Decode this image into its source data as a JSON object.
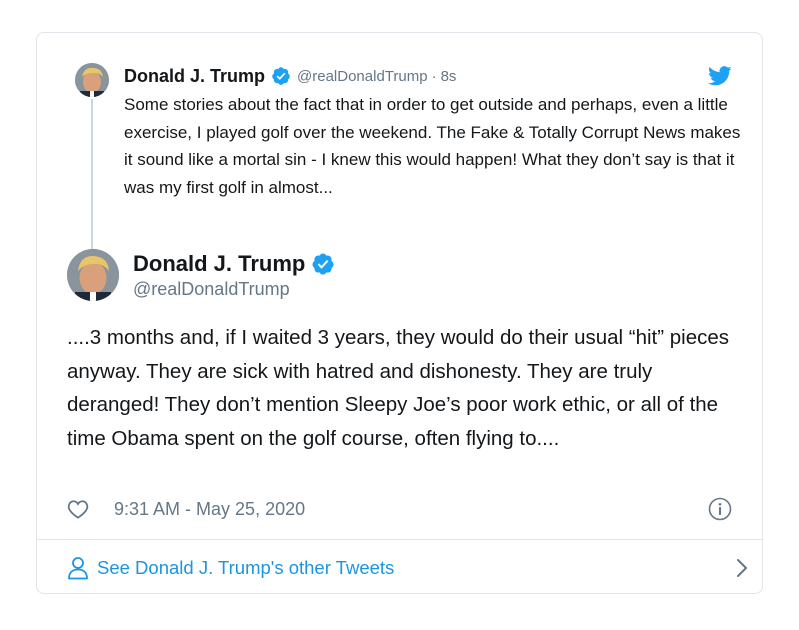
{
  "parent_tweet": {
    "display_name": "Donald J. Trump",
    "handle": "@realDonaldTrump",
    "separator": "·",
    "time_ago": "8s",
    "text": "Some stories about the fact that in order to get outside and perhaps, even a little exercise, I played golf over the weekend. The Fake & Totally Corrupt News makes it sound like a mortal sin - I knew this would happen! What they don’t say is that it was my first golf in almost...",
    "avatar_icon": "profile-photo",
    "verified_icon": "verified-badge-icon"
  },
  "main_tweet": {
    "display_name": "Donald J. Trump",
    "handle": "@realDonaldTrump",
    "text": "....3 months and, if I waited 3 years, they would do their usual “hit” pieces anyway. They are sick with hatred and dishonesty. They are truly deranged! They don’t mention Sleepy Joe’s poor work ethic,  or all of the time Obama spent on the golf course, often flying to....",
    "timestamp": "9:31 AM - May 25, 2020",
    "like_icon": "heart-icon",
    "info_icon": "info-icon"
  },
  "footer": {
    "label": "See Donald J. Trump's other Tweets",
    "icon": "person-icon",
    "chevron_icon": "chevron-right-icon"
  },
  "colors": {
    "brand_blue": "#1da1f2",
    "link_blue": "#1b95e0",
    "text_primary": "#14171a",
    "text_secondary": "#657786",
    "border": "#dfe5ea"
  }
}
